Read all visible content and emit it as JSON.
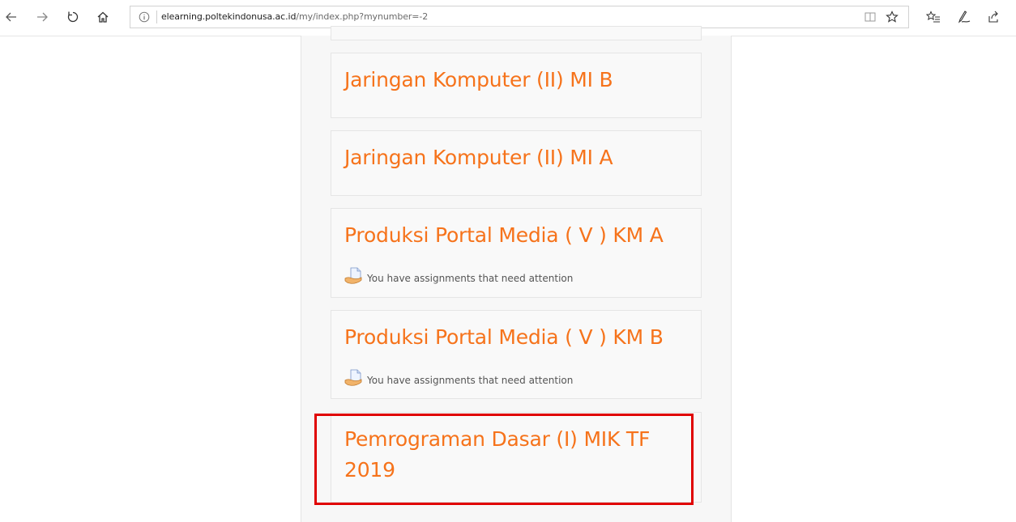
{
  "browser": {
    "url_host": "elearning.poltekindonusa.ac.id",
    "url_path": "/my/index.php?mynumber=-2",
    "icons": [
      "back-icon",
      "forward-icon",
      "refresh-icon",
      "home-icon",
      "info-icon",
      "reading-view-icon",
      "favorite-star-icon",
      "favorites-list-icon",
      "pen-icon",
      "share-icon"
    ]
  },
  "courses": [
    {
      "title": "Jaringan Komputer (II) MI B",
      "notice": ""
    },
    {
      "title": "Jaringan Komputer (II) MI A",
      "notice": ""
    },
    {
      "title": "Produksi Portal Media ( V ) KM A",
      "notice": "You have assignments that need attention"
    },
    {
      "title": "Produksi Portal Media ( V ) KM B",
      "notice": "You have assignments that need attention"
    },
    {
      "title": "Pemrograman Dasar (I) MIK TF 2019",
      "notice": ""
    }
  ],
  "colors": {
    "course_title": "#f6731b",
    "highlight_border": "#e00000"
  }
}
